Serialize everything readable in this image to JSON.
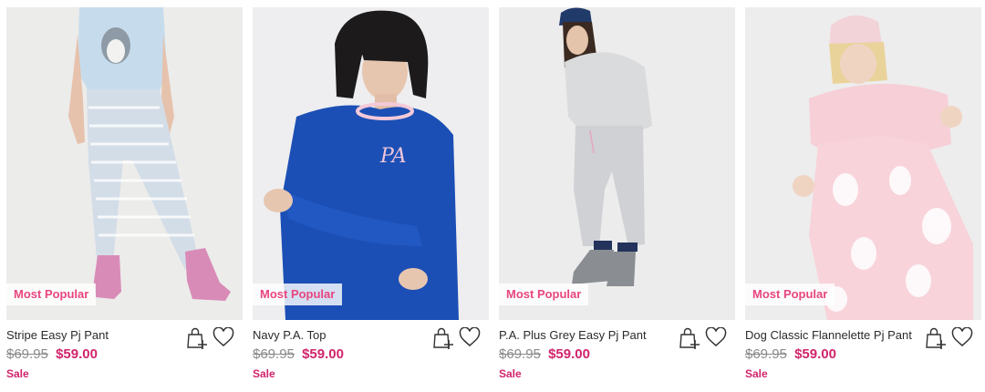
{
  "products": [
    {
      "name": "Stripe Easy Pj Pant",
      "was_price": "$69.95",
      "price": "$59.00",
      "sale_label": "Sale",
      "badge": "Most Popular",
      "icons": {
        "bag": "add-to-bag-icon",
        "wish": "heart-icon"
      }
    },
    {
      "name": "Navy P.A. Top",
      "was_price": "$69.95",
      "price": "$59.00",
      "sale_label": "Sale",
      "badge": "Most Popular",
      "icons": {
        "bag": "add-to-bag-icon",
        "wish": "heart-icon"
      }
    },
    {
      "name": "P.A. Plus Grey Easy Pj Pant",
      "was_price": "$69.95",
      "price": "$59.00",
      "sale_label": "Sale",
      "badge": "Most Popular",
      "icons": {
        "bag": "add-to-bag-icon",
        "wish": "heart-icon"
      }
    },
    {
      "name": "Dog Classic Flannelette Pj Pant",
      "was_price": "$69.95",
      "price": "$59.00",
      "sale_label": "Sale",
      "badge": "Most Popular",
      "icons": {
        "bag": "add-to-bag-icon",
        "wish": "heart-icon"
      }
    }
  ],
  "colors": {
    "badge_text": "#e8457f",
    "sale_price": "#d1246c",
    "was_price": "#8a8a8a",
    "text": "#2b2b2b"
  }
}
